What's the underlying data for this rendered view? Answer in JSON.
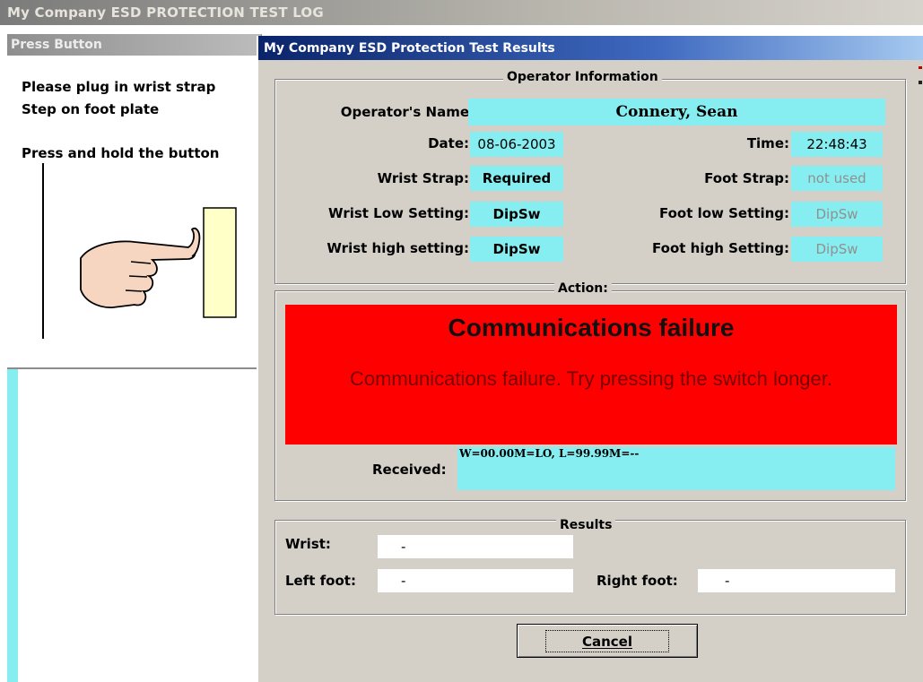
{
  "app": {
    "title": "My Company ESD PROTECTION TEST LOG"
  },
  "press_panel": {
    "title": "Press Button",
    "instructions": [
      "Please plug in wrist strap",
      "Step on foot plate",
      "Press and hold the button"
    ]
  },
  "dialog": {
    "title": "My Company ESD Protection Test Results",
    "operator": {
      "legend": "Operator Information",
      "name_label": "Operator's Name",
      "name_value": "Connery, Sean",
      "date_label": "Date:",
      "date_value": "08-06-2003",
      "time_label": "Time:",
      "time_value": "22:48:43",
      "wrist_strap_label": "Wrist Strap:",
      "wrist_strap_value": "Required",
      "foot_strap_label": "Foot Strap:",
      "foot_strap_value": "not used",
      "wrist_low_label": "Wrist Low Setting:",
      "wrist_low_value": "DipSw",
      "foot_low_label": "Foot low Setting:",
      "foot_low_value": "DipSw",
      "wrist_high_label": "Wrist high setting:",
      "wrist_high_value": "DipSw",
      "foot_high_label": "Foot high Setting:",
      "foot_high_value": "DipSw"
    },
    "action": {
      "legend": "Action:",
      "headline": "Communications failure",
      "message": "Communications failure.  Try pressing the switch longer.",
      "received_label": "Received:",
      "received_value": "W=00.00M=LO, L=99.99M=--"
    },
    "results": {
      "legend": "Results",
      "wrist_label": "Wrist:",
      "wrist_value": "-",
      "left_foot_label": "Left foot:",
      "left_foot_value": "-",
      "right_foot_label": "Right foot:",
      "right_foot_value": "-"
    },
    "cancel_label": "Cancel"
  },
  "colors": {
    "dialog_title_bar": "#0a246a",
    "field_cyan": "#86eef0",
    "action_red": "#ff0000",
    "window_face": "#d4d0c8"
  },
  "icons": {
    "press_illustration": "hand-pressing-button-icon"
  }
}
